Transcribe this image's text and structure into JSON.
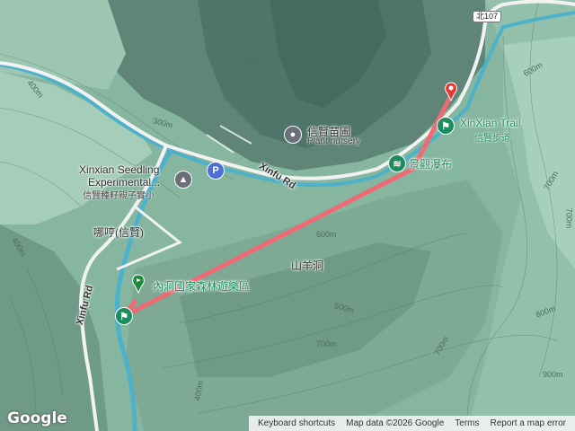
{
  "map": {
    "roads": {
      "xinfu_rd_upper": "Xinfu Rd",
      "xinfu_rd_lower": "Xinfu Rd",
      "shield_107": "北107"
    },
    "places": {
      "seedling_line1": "Xinxian Seedling",
      "seedling_line2": "Experimental...",
      "seedling_chinese": "信賢種籽親子實小",
      "plant_nursery_zh": "信賢苗圃",
      "plant_nursery_en": "Plant nursery",
      "naheng": "哪哼(信賢)",
      "recreation_area": "內洞國家森林遊樂區",
      "xinxian_trail": "XinXian Trail",
      "xinxian_trail_zh": "信賢步道",
      "waterfall": "景觀瀑布",
      "goat_cave": "山羊洞"
    },
    "contours": [
      "500m",
      "400m",
      "300m",
      "400m",
      "600m",
      "700m",
      "600m",
      "700m",
      "700m",
      "800m",
      "900m",
      "400m",
      "500m",
      "700m"
    ],
    "route_color": "#f06a73",
    "route_description": "Straight line route from trail start pin near 內洞國家森林遊樂區 to end pin near XinXian Trail"
  },
  "poi_icons": {
    "hiking": "hiking-icon",
    "school": "school-icon",
    "parking": "P",
    "nursery": "pin-icon"
  },
  "logo": "Google",
  "attribution": {
    "shortcuts": "Keyboard shortcuts",
    "data": "Map data ©2026 Google",
    "terms": "Terms",
    "report": "Report a map error"
  }
}
